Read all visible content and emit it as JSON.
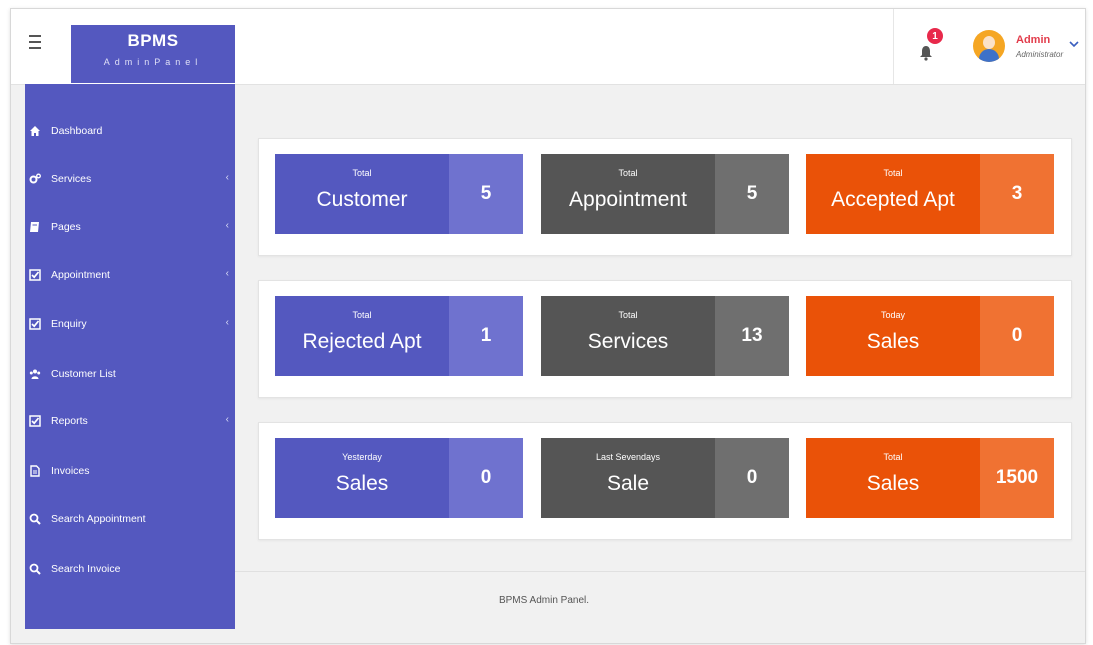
{
  "header": {
    "brand_title": "BPMS",
    "brand_subtitle": "AdminPanel",
    "notification_count": "1",
    "user_name": "Admin",
    "user_role": "Administrator"
  },
  "sidebar": {
    "items": [
      {
        "label": "Dashboard",
        "icon": "home-icon",
        "has_submenu": false
      },
      {
        "label": "Services",
        "icon": "cogs-icon",
        "has_submenu": true
      },
      {
        "label": "Pages",
        "icon": "book-icon",
        "has_submenu": true
      },
      {
        "label": "Appointment",
        "icon": "check-square-icon",
        "has_submenu": true
      },
      {
        "label": "Enquiry",
        "icon": "check-square-icon",
        "has_submenu": true
      },
      {
        "label": "Customer List",
        "icon": "users-icon",
        "has_submenu": false
      },
      {
        "label": "Reports",
        "icon": "check-square-icon",
        "has_submenu": true
      },
      {
        "label": "Invoices",
        "icon": "file-icon",
        "has_submenu": false
      },
      {
        "label": "Search Appointment",
        "icon": "search-icon",
        "has_submenu": false
      },
      {
        "label": "Search Invoice",
        "icon": "search-icon",
        "has_submenu": false
      }
    ]
  },
  "stats": [
    {
      "small": "Total",
      "big": "Customer",
      "value": "5",
      "color": "blue"
    },
    {
      "small": "Total",
      "big": "Appointment",
      "value": "5",
      "color": "gray"
    },
    {
      "small": "Total",
      "big": "Accepted Apt",
      "value": "3",
      "color": "orange"
    },
    {
      "small": "Total",
      "big": "Rejected Apt",
      "value": "1",
      "color": "blue"
    },
    {
      "small": "Total",
      "big": "Services",
      "value": "13",
      "color": "gray"
    },
    {
      "small": "Today",
      "big": "Sales",
      "value": "0",
      "color": "orange"
    },
    {
      "small": "Yesterday",
      "big": "Sales",
      "value": "0",
      "color": "blue"
    },
    {
      "small": "Last Sevendays",
      "big": "Sale",
      "value": "0",
      "color": "gray"
    },
    {
      "small": "Total",
      "big": "Sales",
      "value": "1500",
      "color": "orange"
    }
  ],
  "footer": {
    "text": "BPMS Admin Panel."
  },
  "colors": {
    "brand_blue": "#5458bf",
    "card_gray": "#555555",
    "card_orange": "#ea5208",
    "badge_red": "#e8294b",
    "page_bg": "#f1f1f1"
  }
}
